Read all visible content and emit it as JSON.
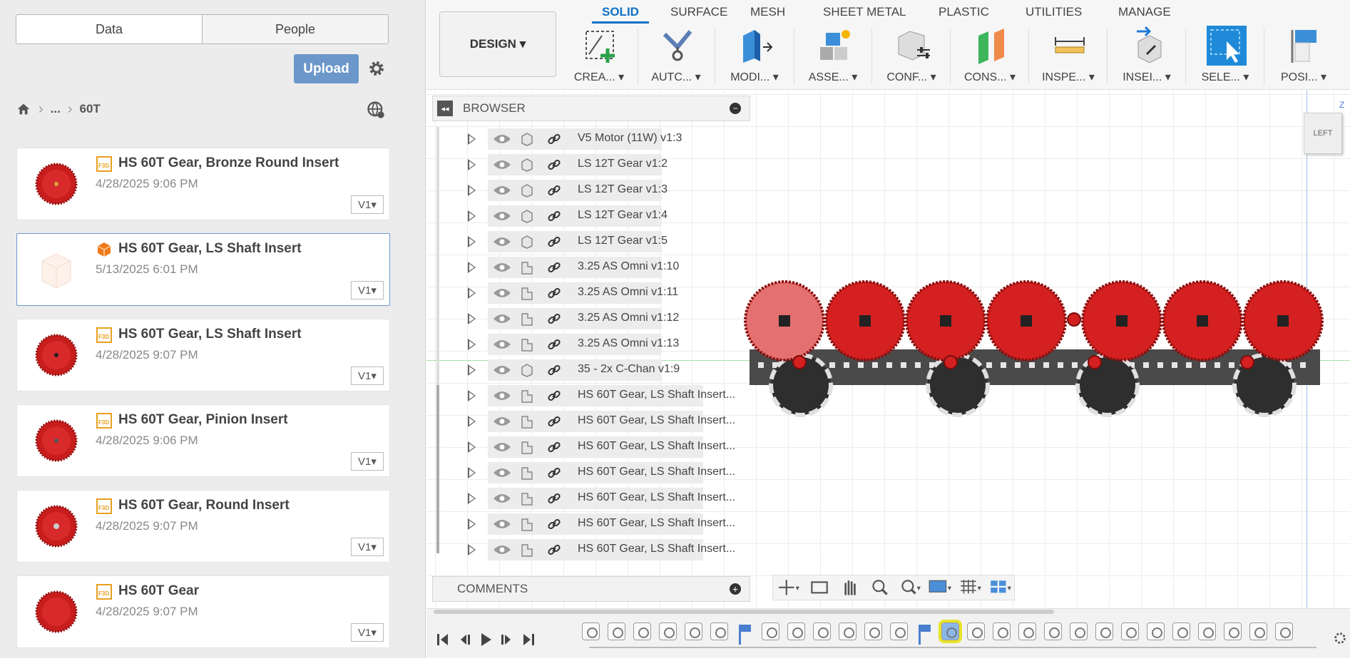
{
  "data_panel": {
    "tabs": [
      "Data",
      "People"
    ],
    "upload_label": "Upload",
    "breadcrumb": {
      "ellipsis": "...",
      "current": "60T"
    },
    "files": [
      {
        "title": "HS 60T Gear, Bronze Round Insert",
        "date": "4/28/2025 9:06 PM",
        "version": "V1",
        "type": "F3D"
      },
      {
        "title": "HS 60T Gear, LS Shaft Insert",
        "date": "5/13/2025 6:01 PM",
        "version": "V1",
        "type": "box"
      },
      {
        "title": "HS 60T Gear, LS Shaft Insert",
        "date": "4/28/2025 9:07 PM",
        "version": "V1",
        "type": "F3D"
      },
      {
        "title": "HS 60T Gear, Pinion Insert",
        "date": "4/28/2025 9:06 PM",
        "version": "V1",
        "type": "F3D"
      },
      {
        "title": "HS 60T Gear, Round Insert",
        "date": "4/28/2025 9:07 PM",
        "version": "V1",
        "type": "F3D"
      },
      {
        "title": "HS 60T Gear",
        "date": "4/28/2025 9:07 PM",
        "version": "V1",
        "type": "F3D"
      }
    ]
  },
  "toolbar": {
    "workspace": "DESIGN",
    "tabs": [
      "SOLID",
      "SURFACE",
      "MESH",
      "SHEET METAL",
      "PLASTIC",
      "UTILITIES",
      "MANAGE"
    ],
    "active_tab": "SOLID",
    "tools": [
      "CREA...",
      "AUTC...",
      "MODI...",
      "ASSE...",
      "CONF...",
      "CONS...",
      "INSPE...",
      "INSEI...",
      "SELE...",
      "POSI..."
    ]
  },
  "browser": {
    "title": "BROWSER",
    "items": [
      "V5 Motor (11W) v1:3",
      "LS 12T Gear v1:2",
      "LS 12T Gear v1:3",
      "LS 12T Gear v1:4",
      "LS 12T Gear v1:5",
      "3.25 AS Omni v1:10",
      "3.25 AS Omni v1:11",
      "3.25 AS Omni v1:12",
      "3.25 AS Omni v1:13",
      "35 - 2x C-Chan v1:9",
      "HS 60T Gear, LS Shaft Insert...",
      "HS 60T Gear, LS Shaft Insert...",
      "HS 60T Gear, LS Shaft Insert...",
      "HS 60T Gear, LS Shaft Insert...",
      "HS 60T Gear, LS Shaft Insert...",
      "HS 60T Gear, LS Shaft Insert...",
      "HS 60T Gear, LS Shaft Insert..."
    ]
  },
  "comments": {
    "title": "COMMENTS"
  },
  "viewcube": {
    "face": "LEFT",
    "axis": "Z"
  },
  "colors": {
    "accent": "#0f70c4",
    "upload": "#6b97cb",
    "gear": "#d42020",
    "highlight": "#e8e32a"
  }
}
